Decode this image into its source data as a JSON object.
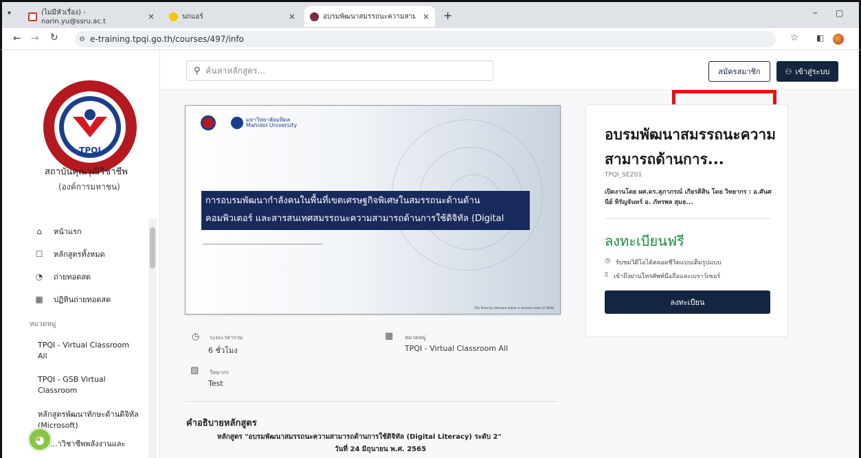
{
  "browser": {
    "tabs": [
      {
        "title": "(ไม่มีหัวเรื่อง) - narin.yu@ssru.ac.t"
      },
      {
        "title": "นกแอร์"
      },
      {
        "title": "อบรมพัฒนาสมรรถนะความสามารถด้"
      }
    ],
    "url": "e-training.tpqi.go.th/courses/497/info"
  },
  "sidebar": {
    "org_name": "สถาบันคุณวุฒิวิชาชีพ",
    "org_sub": "(องค์การมหาชน)",
    "menu": [
      {
        "label": "หน้าแรก",
        "icon": "home-icon"
      },
      {
        "label": "หลักสูตรทั้งหมด",
        "icon": "list-icon"
      },
      {
        "label": "ถ่ายทอดสด",
        "icon": "broadcast-icon"
      },
      {
        "label": "ปฏิทินถ่ายทอดสด",
        "icon": "calendar-icon"
      }
    ],
    "category_heading": "หมวดหมู่",
    "categories": [
      {
        "label": "TPQI - Virtual Classroom All"
      },
      {
        "label": "TPQI - GSB Virtual Classroom"
      },
      {
        "label": "หลักสูตรพัฒนาทักษะด้านดิจิทัล (Microsoft)"
      },
      {
        "label": "...าวิชาชีพพลังงานและ"
      }
    ]
  },
  "header": {
    "search_placeholder": "ค้นหาหลักสูตร...",
    "register_label": "สมัครสมาชิก",
    "login_label": "เข้าสู่ระบบ"
  },
  "hero": {
    "univ_th": "มหาวิทยาลัยมหิดล",
    "univ_en": "Mahidol University",
    "band_text": "การอบรมพัฒนากำลังคนในพื้นที่เขตเศรษฐกิจพิเศษในสมรรถนะด้านด้านคอมพิวเตอร์ และสารสนเทศสมรรถนะความสามารถด้านการใช้ดิจิทัล (Digital Literacy)",
    "credit": "This Photo by Unknown Author is licensed under CC BY-NC"
  },
  "course_info": {
    "duration_label": "ระยะเวลารวม",
    "duration_value": "6 ชั่วโมง",
    "category_label": "หมวดหมู่",
    "category_value": "TPQI - Virtual Classroom All",
    "lecturer_label": "วิทยากร",
    "lecturer_value": "Test"
  },
  "description": {
    "title": "คำอธิบายหลักสูตร",
    "line1": "หลักสูตร \"อบรมพัฒนาสมรรถนะความสามารถด้านการใช้ดิจิทัล (Digital Literacy) ระดับ 2\"",
    "line2": "วันที่ 24 มิถุนายน พ.ศ. 2565"
  },
  "card": {
    "title": "อบรมพัฒนาสมรรถนะความสามารถด้านการ...",
    "code": "TPQI_SEZ01",
    "by": "เปิดงานโดย ผศ.ดร.สุภาภรณ์ เกียรติสิน โดย วิทยากร : อ.ศันศนีย์ หิรัญจันทร์ อ. ภัทรพล สุมธ...",
    "price": "ลงทะเบียนฟรี",
    "features": [
      {
        "text": "รับชมวิดีโอได้ตลอดชีวิตแบบเต็มรูปแบบ",
        "icon": "clock-icon"
      },
      {
        "text": "เข้าถึงผ่านโทรศัพท์มือถือและเบราว์เซอร์",
        "icon": "phone-icon"
      }
    ],
    "button": "ลงทะเบียน"
  }
}
